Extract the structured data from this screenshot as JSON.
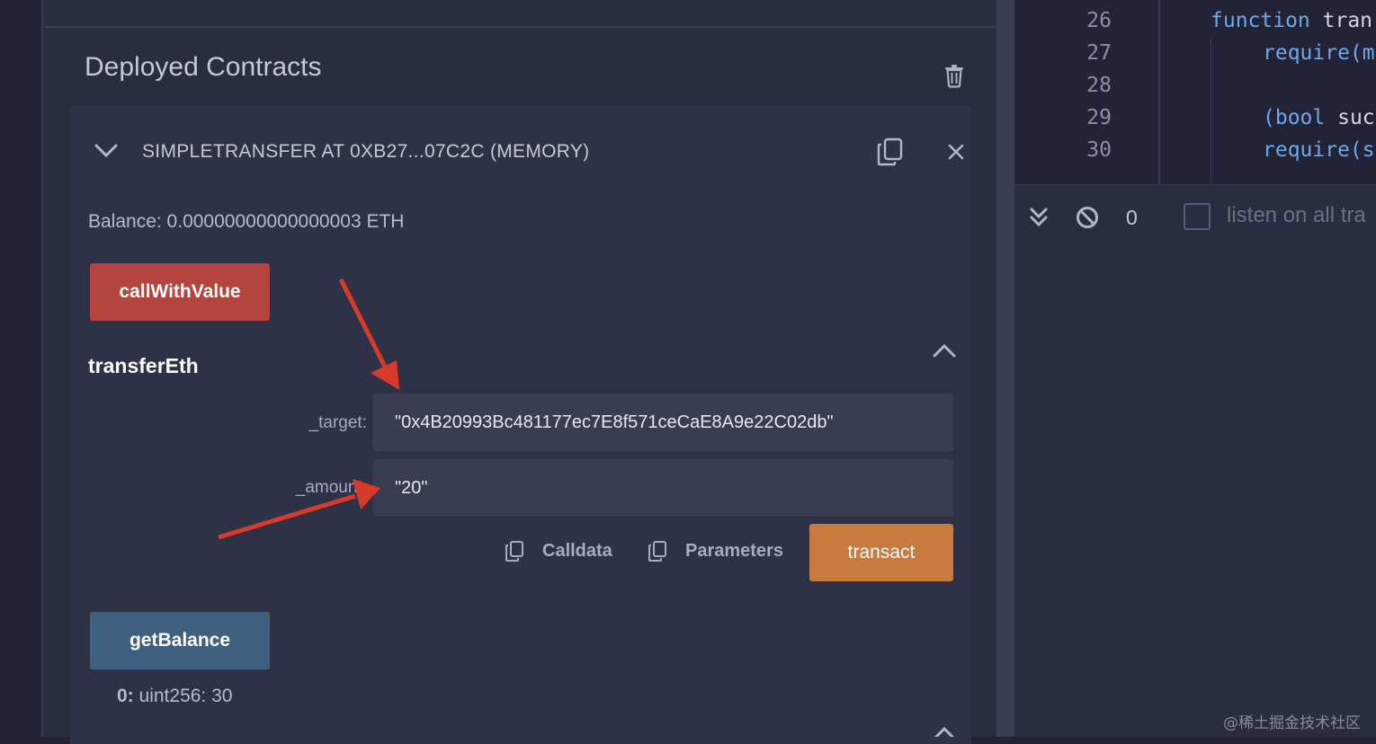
{
  "panel": {
    "title": "Deployed Contracts"
  },
  "contract": {
    "header": "SIMPLETRANSFER AT 0XB27...07C2C (MEMORY)",
    "balance": "Balance: 0.00000000000000003 ETH",
    "call_with_value_label": "callWithValue",
    "function_name": "transferEth",
    "params": [
      {
        "label": "_target:",
        "value": "\"0x4B20993Bc481177ec7E8f571ceCaE8A9e22C02db\""
      },
      {
        "label": "_amount:",
        "value": "\"20\""
      }
    ],
    "calldata_label": "Calldata",
    "parameters_label": "Parameters",
    "transact_label": "transact",
    "get_balance_label": "getBalance",
    "result_index": "0:",
    "result_value": "uint256: 30"
  },
  "editor": {
    "lines": [
      {
        "num": "26",
        "kw": "function",
        "rest": " tran"
      },
      {
        "num": "27",
        "kw": "require(",
        "rest": "m"
      },
      {
        "num": "28",
        "kw": "",
        "rest": ""
      },
      {
        "num": "29",
        "kw": "(bool",
        "rest": " suc"
      },
      {
        "num": "30",
        "kw": "require(",
        "rest": "s"
      }
    ]
  },
  "terminal": {
    "count": "0",
    "listen_label": "listen on all tra"
  },
  "watermark": "@稀土掘金技术社区",
  "colors": {
    "call_with_value": "#b5443f",
    "transact": "#c97a3e",
    "get_balance": "#3f5f7e",
    "arrow": "#d63a2a"
  }
}
